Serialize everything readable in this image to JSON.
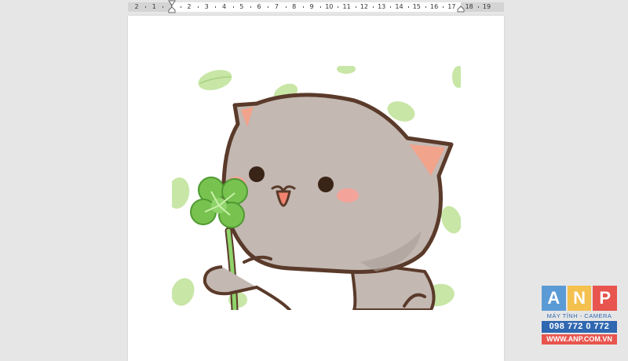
{
  "ruler": {
    "labels": [
      "2",
      "1",
      "1",
      "2",
      "3",
      "4",
      "5",
      "6",
      "7",
      "8",
      "9",
      "10",
      "11",
      "12",
      "13",
      "14",
      "15",
      "16",
      "17",
      "18",
      "19"
    ]
  },
  "logo": {
    "letters": [
      "A",
      "N",
      "P"
    ],
    "letter_colors": [
      "#5b9bd5",
      "#f4c04e",
      "#e8554e"
    ],
    "tagline": "MÁY TÍNH - CAMERA",
    "phone": "098 772 0 772",
    "website": "WWW.ANP.COM.VN"
  },
  "document": {
    "image_icon": "cat-with-clover-image"
  }
}
